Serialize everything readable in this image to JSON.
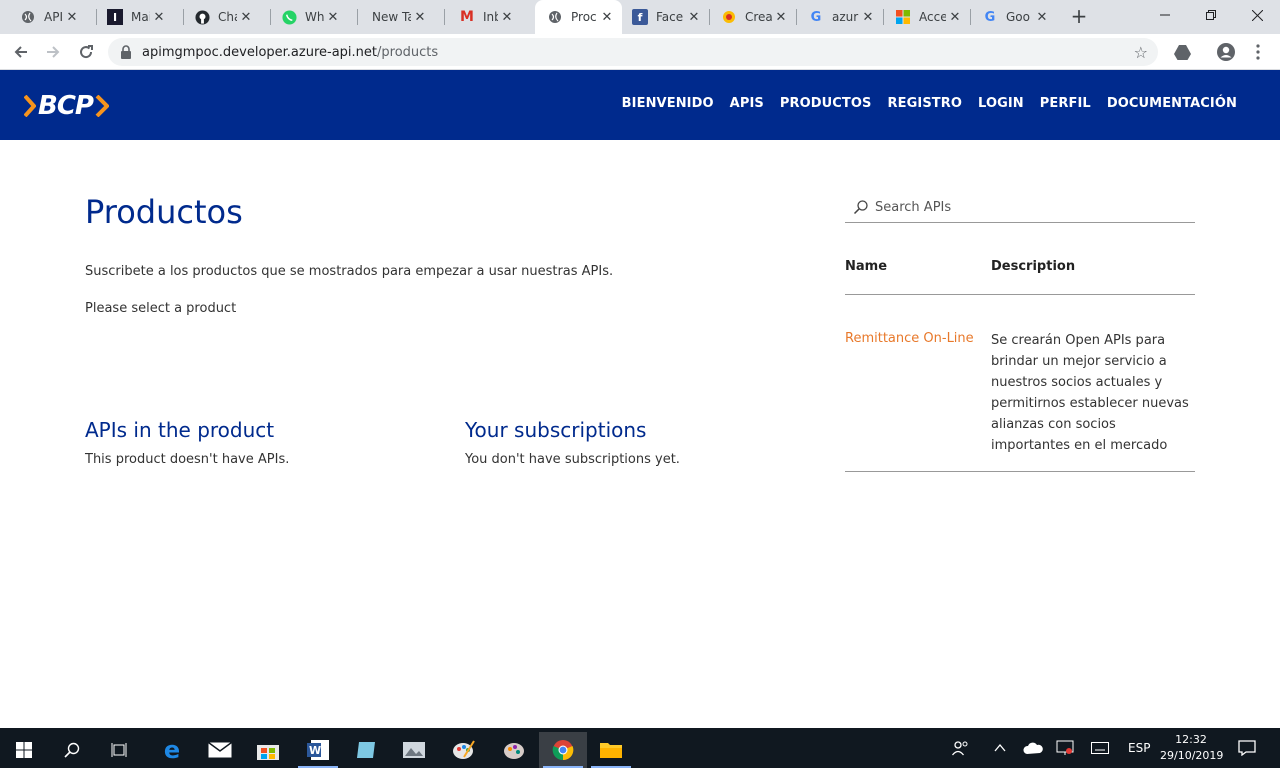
{
  "browser": {
    "tabs": [
      {
        "title": "API M",
        "icon": "globe-icon"
      },
      {
        "title": "Mail",
        "icon": "mail-favicon"
      },
      {
        "title": "Char",
        "icon": "github-icon"
      },
      {
        "title": "Wha",
        "icon": "whatsapp-icon"
      },
      {
        "title": "New Tab",
        "icon": ""
      },
      {
        "title": "Inbo",
        "icon": "gmail-icon"
      },
      {
        "title": "Proc",
        "icon": "globe-icon"
      },
      {
        "title": "Face",
        "icon": "facebook-icon"
      },
      {
        "title": "Crea",
        "icon": "create-favicon"
      },
      {
        "title": "azur",
        "icon": "google-icon"
      },
      {
        "title": "Acce",
        "icon": "microsoft-icon"
      },
      {
        "title": "Goo",
        "icon": "google-icon"
      }
    ],
    "url_host": "apimgmpoc.developer.azure-api.net",
    "url_path": "/products"
  },
  "site": {
    "logo_text": "BCP",
    "nav": [
      "BIENVENIDO",
      "APIS",
      "PRODUCTOS",
      "REGISTRO",
      "LOGIN",
      "PERFIL",
      "DOCUMENTACIÓN"
    ],
    "brand_color": "#002a8d",
    "accent_color": "#f7941d"
  },
  "main": {
    "title": "Productos",
    "lead": "Suscribete a los productos que se mostrados para empezar a usar nuestras APIs.",
    "select_msg": "Please select a product",
    "apis_title": "APIs in the product",
    "apis_text": "This product doesn't have APIs.",
    "subs_title": "Your subscriptions",
    "subs_text": "You don't have subscriptions yet."
  },
  "sidebar": {
    "search_placeholder": "Search APIs",
    "col_name": "Name",
    "col_desc": "Description",
    "products": [
      {
        "name": "Remittance On-Line",
        "description": "Se crearán Open APIs para brindar un mejor servicio a nuestros socios actuales y permitirnos establecer nuevas alianzas con socios importantes en el mercado"
      }
    ]
  },
  "taskbar": {
    "language": "ESP",
    "time": "12:32",
    "date": "29/10/2019"
  }
}
